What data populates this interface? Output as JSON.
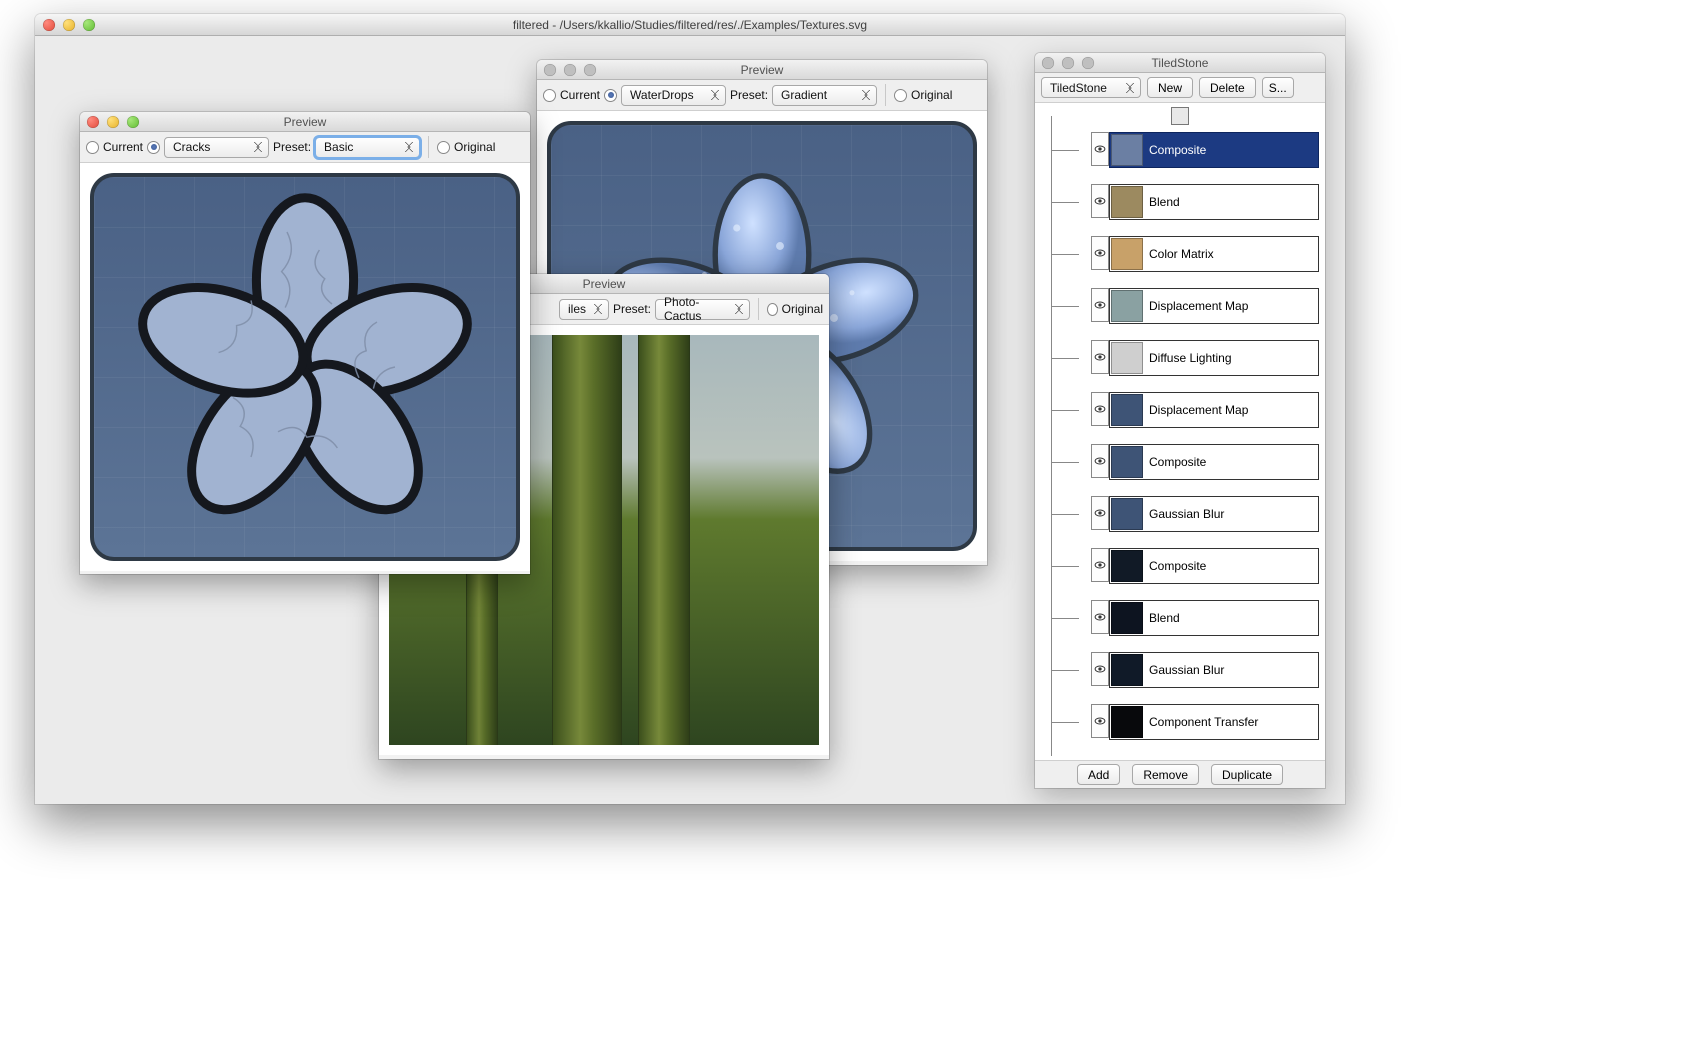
{
  "mainWindow": {
    "title": "filtered - /Users/kkallio/Studies/filtered/res/./Examples/Textures.svg"
  },
  "preview1": {
    "title": "Preview",
    "currentLabel": "Current",
    "dropdown1": "Cracks",
    "presetLabel": "Preset:",
    "dropdown2": "Basic",
    "originalLabel": "Original"
  },
  "preview2": {
    "title": "Preview",
    "currentLabel": "Current",
    "dropdown1": "WaterDrops",
    "presetLabel": "Preset:",
    "dropdown2": "Gradient",
    "originalLabel": "Original"
  },
  "preview3": {
    "title": "Preview",
    "filesLabel": "iles",
    "presetLabel": "Preset:",
    "dropdown1": "Photo-Cactus",
    "originalLabel": "Original"
  },
  "panel": {
    "title": "TiledStone",
    "dropdown": "TiledStone",
    "newBtn": "New",
    "deleteBtn": "Delete",
    "sBtn": "S...",
    "addBtn": "Add",
    "removeBtn": "Remove",
    "duplicateBtn": "Duplicate",
    "nodes": [
      {
        "label": "Composite",
        "selected": true,
        "swatch": "#6b7fa3",
        "icon": "flower"
      },
      {
        "label": "Blend",
        "selected": false,
        "swatch": "#9c8a60",
        "icon": "tile"
      },
      {
        "label": "Color Matrix",
        "selected": false,
        "swatch": "#c8a169",
        "icon": "solid"
      },
      {
        "label": "Displacement Map",
        "selected": false,
        "swatch": "#8aa1a2",
        "icon": "solid"
      },
      {
        "label": "Diffuse Lighting",
        "selected": false,
        "swatch": "#cfcfcf",
        "icon": "bumpy"
      },
      {
        "label": "Displacement Map",
        "selected": false,
        "swatch": "#3e5476",
        "icon": "flower"
      },
      {
        "label": "Composite",
        "selected": false,
        "swatch": "#3e5476",
        "icon": "flower"
      },
      {
        "label": "Gaussian Blur",
        "selected": false,
        "swatch": "#3e5476",
        "icon": "flower"
      },
      {
        "label": "Composite",
        "selected": false,
        "swatch": "#111a26",
        "icon": "dark"
      },
      {
        "label": "Blend",
        "selected": false,
        "swatch": "#0d1420",
        "icon": "dark"
      },
      {
        "label": "Gaussian Blur",
        "selected": false,
        "swatch": "#101a28",
        "icon": "dark"
      },
      {
        "label": "Component Transfer",
        "selected": false,
        "swatch": "#08090c",
        "icon": "dark"
      }
    ]
  }
}
